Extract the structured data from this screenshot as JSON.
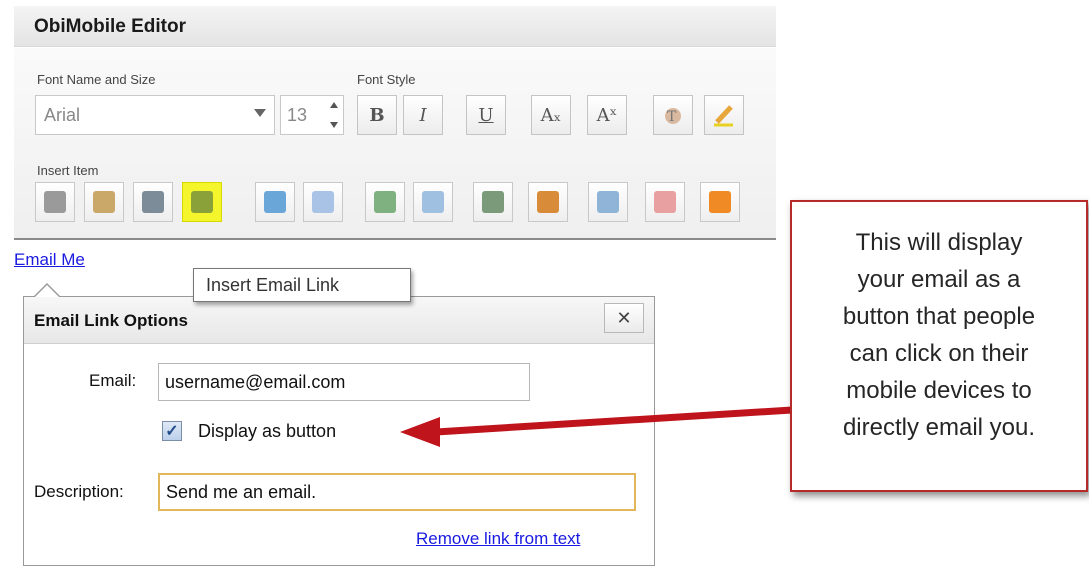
{
  "editor": {
    "title": "ObiMobile Editor"
  },
  "font_group": {
    "label": "Font Name and Size",
    "font_name": "Arial",
    "font_size": "13"
  },
  "style_group": {
    "label": "Font Style",
    "buttons": [
      {
        "name": "bold-button",
        "glyph": "B"
      },
      {
        "name": "italic-button",
        "glyph": "I"
      },
      {
        "name": "underline-button",
        "glyph": "U"
      },
      {
        "name": "subscript-button",
        "glyph": "Aₓ"
      },
      {
        "name": "superscript-button",
        "glyph": "Aˣ"
      },
      {
        "name": "text-color-button",
        "icon": "text-color-icon"
      },
      {
        "name": "highlight-button",
        "icon": "highlighter-icon"
      }
    ]
  },
  "insert_group": {
    "label": "Insert Item",
    "items": [
      {
        "icon": "link-icon",
        "color": "#9a9a9a"
      },
      {
        "icon": "image-icon",
        "color": "#c9a86a"
      },
      {
        "icon": "phone-icon",
        "color": "#7d8c99"
      },
      {
        "icon": "email-icon",
        "color": "#8aa13a",
        "highlighted": true
      },
      {
        "icon": "chart-icon",
        "color": "#6aa6d8"
      },
      {
        "icon": "table-icon",
        "color": "#a9c3e6"
      },
      {
        "icon": "arrow-button-icon",
        "color": "#7fb07f"
      },
      {
        "icon": "form-icon",
        "color": "#9fc0e0"
      },
      {
        "icon": "film-icon",
        "color": "#7a9a7a"
      },
      {
        "icon": "gallery-icon",
        "color": "#d88c3a"
      },
      {
        "icon": "clock-icon",
        "color": "#8fb4d8"
      },
      {
        "icon": "hand-icon",
        "color": "#e8a0a0"
      },
      {
        "icon": "rss-icon",
        "color": "#f08a24"
      }
    ]
  },
  "tooltip": {
    "text": "Insert Email Link"
  },
  "link_text": "Email Me",
  "dialog": {
    "title": "Email Link Options",
    "close_glyph": "✕",
    "email_label": "Email:",
    "email_value": "username@email.com",
    "checkbox_label": "Display as button",
    "checkbox_checked": true,
    "description_label": "Description:",
    "description_value": "Send me an email.",
    "remove_link": "Remove link from text"
  },
  "callout": {
    "lines": [
      "This will display",
      "your email as a",
      "button that people",
      "can click on their",
      "mobile devices to",
      "directly email you."
    ],
    "border_color": "#b72a2a"
  },
  "arrow_color": "#c0141c"
}
